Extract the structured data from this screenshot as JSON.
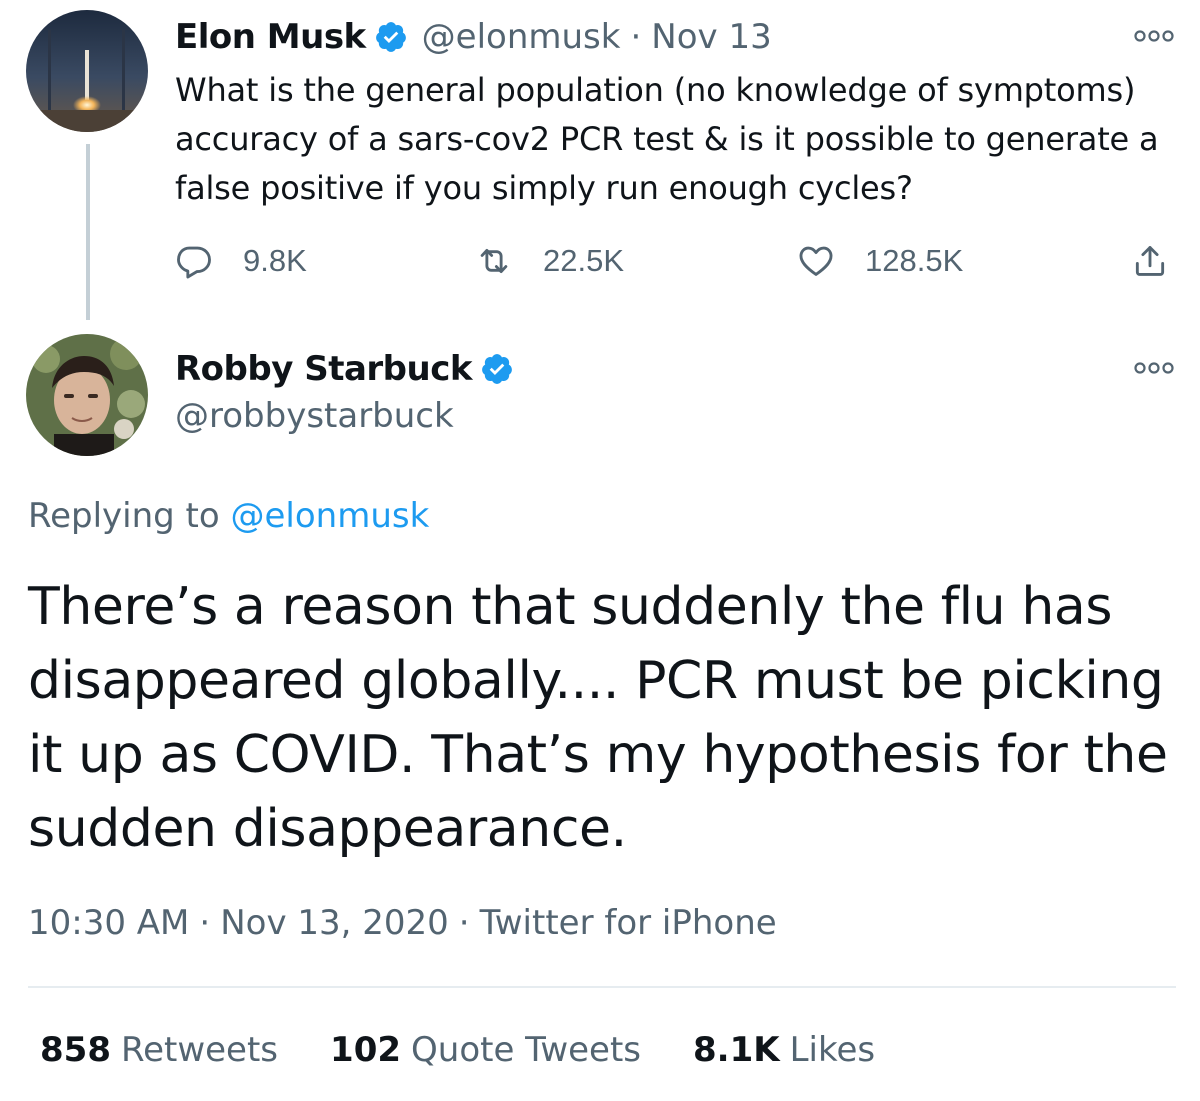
{
  "parent_tweet": {
    "author_name": "Elon Musk",
    "handle": "@elonmusk",
    "separator": "·",
    "date": "Nov 13",
    "text": "What is the general population (no knowledge of symptoms) accuracy of a sars-cov2 PCR test & is it possible to generate a false positive if you simply run enough cycles?",
    "actions": {
      "replies": "9.8K",
      "retweets": "22.5K",
      "likes": "128.5K"
    }
  },
  "main_tweet": {
    "author_name": "Robby Starbuck",
    "handle": "@robbystarbuck",
    "replying_prefix": "Replying to",
    "replying_handle": "@elonmusk",
    "text": "There’s a reason that suddenly the flu has disappeared globally.... PCR must be picking it up as COVID. That’s my hypothesis for the sudden disappearance.",
    "time": "10:30 AM",
    "date": "Nov 13, 2020",
    "source": "Twitter for iPhone",
    "separator": "·",
    "stats": {
      "retweets_count": "858",
      "retweets_label": "Retweets",
      "quotes_count": "102",
      "quotes_label": "Quote Tweets",
      "likes_count": "8.1K",
      "likes_label": "Likes"
    }
  },
  "colors": {
    "text_primary": "#0f1419",
    "text_secondary": "#536471",
    "link": "#1d9bf0",
    "verified_badge": "#1d9bf0",
    "thread_line": "#c4cfd6",
    "divider": "#e6ecf0"
  },
  "icons": {
    "reply": "reply-icon",
    "retweet": "retweet-icon",
    "like": "heart-icon",
    "share": "share-icon",
    "more": "more-options-icon",
    "verified": "verified-badge-icon"
  }
}
